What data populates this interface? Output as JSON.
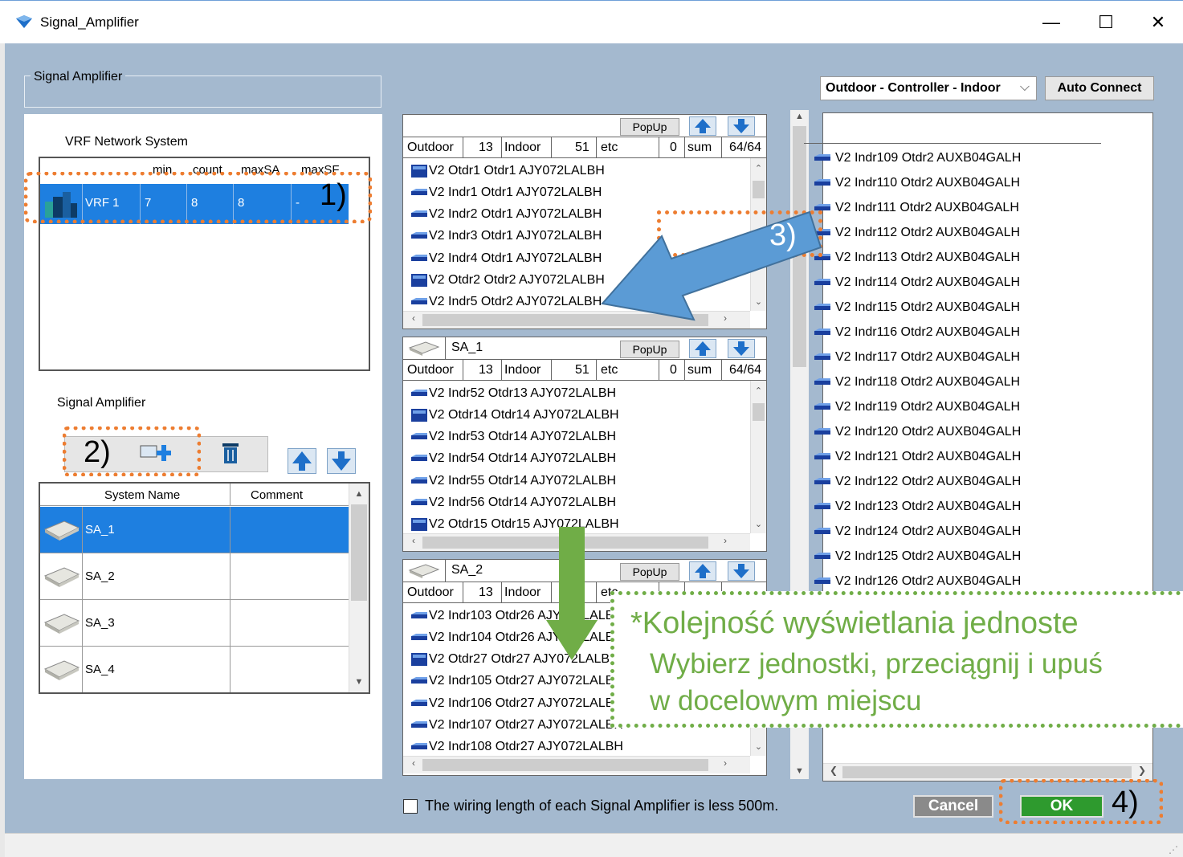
{
  "window": {
    "title": "Signal_Amplifier",
    "minimize": "—",
    "maximize": "☐",
    "close": "✕"
  },
  "groupbox": {
    "label": "Signal Amplifier"
  },
  "vrf": {
    "label": "VRF Network System",
    "headers": [
      "min",
      "count",
      "maxSA",
      "maxSF"
    ],
    "row": {
      "name": "VRF 1",
      "min": "7",
      "count": "8",
      "maxSA": "8",
      "maxSF": "-"
    }
  },
  "sa_section": {
    "label": "Signal Amplifier",
    "headers": {
      "system_name": "System Name",
      "comment": "Comment"
    },
    "rows": [
      "SA_1",
      "SA_2",
      "SA_3",
      "SA_4"
    ]
  },
  "panels": [
    {
      "name": "",
      "popup": "PopUp",
      "counts": {
        "outdoor_label": "Outdoor",
        "outdoor": "13",
        "indoor_label": "Indoor",
        "indoor": "51",
        "etc_label": "etc",
        "etc": "0",
        "sum_label": "sum",
        "sum": "64/64"
      },
      "items": [
        {
          "type": "outdoor",
          "text": "V2  Otdr1  Otdr1  AJY072LALBH"
        },
        {
          "type": "indoor",
          "text": "V2  Indr1  Otdr1  AJY072LALBH"
        },
        {
          "type": "indoor",
          "text": "V2  Indr2  Otdr1  AJY072LALBH"
        },
        {
          "type": "indoor",
          "text": "V2  Indr3  Otdr1  AJY072LALBH"
        },
        {
          "type": "indoor",
          "text": "V2  Indr4  Otdr1  AJY072LALBH"
        },
        {
          "type": "outdoor",
          "text": "V2  Otdr2  Otdr2  AJY072LALBH"
        },
        {
          "type": "indoor",
          "text": "V2  Indr5  Otdr2  AJY072LALBH"
        }
      ]
    },
    {
      "name": "SA_1",
      "popup": "PopUp",
      "counts": {
        "outdoor_label": "Outdoor",
        "outdoor": "13",
        "indoor_label": "Indoor",
        "indoor": "51",
        "etc_label": "etc",
        "etc": "0",
        "sum_label": "sum",
        "sum": "64/64"
      },
      "items": [
        {
          "type": "indoor",
          "text": "V2  Indr52  Otdr13  AJY072LALBH"
        },
        {
          "type": "outdoor",
          "text": "V2  Otdr14  Otdr14  AJY072LALBH"
        },
        {
          "type": "indoor",
          "text": "V2  Indr53  Otdr14  AJY072LALBH"
        },
        {
          "type": "indoor",
          "text": "V2  Indr54  Otdr14  AJY072LALBH"
        },
        {
          "type": "indoor",
          "text": "V2  Indr55  Otdr14  AJY072LALBH"
        },
        {
          "type": "indoor",
          "text": "V2  Indr56  Otdr14  AJY072LALBH"
        },
        {
          "type": "outdoor",
          "text": "V2  Otdr15  Otdr15  AJY072LALBH"
        }
      ]
    },
    {
      "name": "SA_2",
      "popup": "PopUp",
      "counts": {
        "outdoor_label": "Outdoor",
        "outdoor": "13",
        "indoor_label": "Indoor",
        "indoor": "",
        "etc_label": "etc",
        "etc": "",
        "sum_label": "",
        "sum": ""
      },
      "items": [
        {
          "type": "indoor",
          "text": "V2  Indr103  Otdr26  AJY072LALBH"
        },
        {
          "type": "indoor",
          "text": "V2  Indr104  Otdr26  AJY072LALBH"
        },
        {
          "type": "outdoor",
          "text": "V2  Otdr27  Otdr27  AJY072LALBH"
        },
        {
          "type": "indoor",
          "text": "V2  Indr105  Otdr27  AJY072LALBH"
        },
        {
          "type": "indoor",
          "text": "V2  Indr106  Otdr27  AJY072LALBH"
        },
        {
          "type": "indoor",
          "text": "V2  Indr107  Otdr27  AJY072LALBH"
        },
        {
          "type": "indoor",
          "text": "V2  Indr108  Otdr27  AJY072LALBH"
        }
      ]
    }
  ],
  "right": {
    "combo": "Outdoor - Controller - Indoor",
    "auto_connect": "Auto Connect",
    "items": [
      "V2  Indr109  Otdr2  AUXB04GALH",
      "V2  Indr110  Otdr2  AUXB04GALH",
      "V2  Indr111  Otdr2  AUXB04GALH",
      "V2  Indr112  Otdr2  AUXB04GALH",
      "V2  Indr113  Otdr2  AUXB04GALH",
      "V2  Indr114  Otdr2  AUXB04GALH",
      "V2  Indr115  Otdr2  AUXB04GALH",
      "V2  Indr116  Otdr2  AUXB04GALH",
      "V2  Indr117  Otdr2  AUXB04GALH",
      "V2  Indr118  Otdr2  AUXB04GALH",
      "V2  Indr119  Otdr2  AUXB04GALH",
      "V2  Indr120  Otdr2  AUXB04GALH",
      "V2  Indr121  Otdr2  AUXB04GALH",
      "V2  Indr122  Otdr2  AUXB04GALH",
      "V2  Indr123  Otdr2  AUXB04GALH",
      "V2  Indr124  Otdr2  AUXB04GALH",
      "V2  Indr125  Otdr2  AUXB04GALH",
      "V2  Indr126  Otdr2  AUXB04GALH"
    ]
  },
  "footer": {
    "checkbox_label": "The wiring length of each Signal Amplifier is less 500m.",
    "cancel": "Cancel",
    "ok": "OK"
  },
  "annotations": {
    "n1": "1)",
    "n2": "2)",
    "n3": "3)",
    "n4": "4)",
    "callout_line1": "*Kolejność wyświetlania jednoste",
    "callout_line2": "Wybierz jednostki, przeciągnij i upuś",
    "callout_line3": "w docelowym miejscu"
  },
  "colors": {
    "client_bg": "#a4b9cf",
    "selection": "#1e7fe0",
    "orange_marker": "#ed7d31",
    "green_callout": "#70ad47",
    "arrow_blue": "#5b9bd5",
    "ok_green": "#2e9a2e"
  }
}
